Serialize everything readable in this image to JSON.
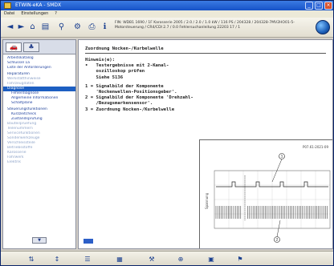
{
  "window": {
    "title": "ETWIN-eKA - SMDX",
    "min_glyph": "_",
    "max_glyph": "□",
    "close_glyph": "×"
  },
  "menu": [
    "Datei",
    "Einstellungen",
    "?"
  ],
  "toolbar": {
    "info_line1": "FIN: WDB1 1690 / 1F Karosserie 2005 / 2.0 / 2.0 / 1.0 kW / 116 PS / 204328 / 204328-7MV2HO01-5-",
    "info_line2": "Motorsteuerung / CR4/CDI 2.7 / 0.0 Fehlersuchanleitung 22203 17 / 1",
    "icons": [
      "back-icon",
      "forward-icon",
      "home-icon",
      "document-icon",
      "search-icon",
      "settings-icon",
      "print-icon",
      "info-icon"
    ]
  },
  "sidebar": {
    "tabs": [
      "car-icon",
      "manual-icon"
    ],
    "items": [
      {
        "label": "Arbeitskatalog",
        "kind": "normal"
      },
      {
        "label": "Schlüssel 1a",
        "kind": "normal"
      },
      {
        "label": "Liste der Anforderungen",
        "kind": "normal"
      },
      {
        "label": "Reparaturen",
        "kind": "head"
      },
      {
        "label": "Werkstatthinweise",
        "kind": "muted"
      },
      {
        "label": "Fahrzeugdaten",
        "kind": "muted"
      },
      {
        "label": "Diagnose",
        "kind": "selected"
      },
      {
        "label": "Fehlerdiagnose",
        "kind": "indent"
      },
      {
        "label": "Allgemeine Informationen",
        "kind": "indent"
      },
      {
        "label": "Schaltpläne",
        "kind": "indent"
      },
      {
        "label": "Steuerungsfunktionen",
        "kind": "head"
      },
      {
        "label": "Kurzzeitcheck",
        "kind": "indent"
      },
      {
        "label": "Zustandsprüfung",
        "kind": "indent"
      },
      {
        "label": "Bauteilpruefung",
        "kind": "muted"
      },
      {
        "label": "Teilenummern",
        "kind": "muted"
      },
      {
        "label": "Servicefunktionen",
        "kind": "muted"
      },
      {
        "label": "Sonderwerkzeuge",
        "kind": "muted"
      },
      {
        "label": "Verschleissteile",
        "kind": "muted"
      },
      {
        "label": "Betriebsstoffe",
        "kind": "muted"
      },
      {
        "label": "Karosserie",
        "kind": "muted"
      },
      {
        "label": "Fahrwerk",
        "kind": "muted"
      },
      {
        "label": "Elektrik",
        "kind": "muted"
      }
    ],
    "scroll_glyph": "▼"
  },
  "content": {
    "title": "Zuordnung Nocken-/Kurbelwelle",
    "lines": [
      {
        "text": "Hinweis(e):",
        "gap_before": false
      },
      {
        "text": "•   Testergebnisse mit 2-Kanal-",
        "gap_before": false
      },
      {
        "text": "    oszilloskop prüfen",
        "gap_before": false
      },
      {
        "text": "    Siehe 5136",
        "gap_before": false
      },
      {
        "text": "1 = Signalbild der Komponente",
        "gap_before": true
      },
      {
        "text": "    'Nockenwellen-Positionsgeber'.",
        "gap_before": false
      },
      {
        "text": "2 = Signalbild der Komponente 'Drehzahl-",
        "gap_before": false
      },
      {
        "text": "    /Bezugsmarkensensor'.",
        "gap_before": false
      },
      {
        "text": "3 = Zuordnung Nocken-/Kurbelwelle",
        "gap_before": false
      }
    ],
    "figure_ref": "P07.61-2021-09",
    "callouts": [
      "1",
      "2"
    ],
    "y_axis_label": "Spannung"
  },
  "statusbar": {
    "buttons": [
      "back-nav-icon",
      "up-nav-icon",
      "list-icon",
      "chart-icon",
      "tools-icon",
      "zoom-icon",
      "car-status-icon",
      "flag-icon"
    ]
  },
  "colors": {
    "accent": "#1d5fc2",
    "title_bar": "#1652c7",
    "link": "#1d3f9e"
  }
}
